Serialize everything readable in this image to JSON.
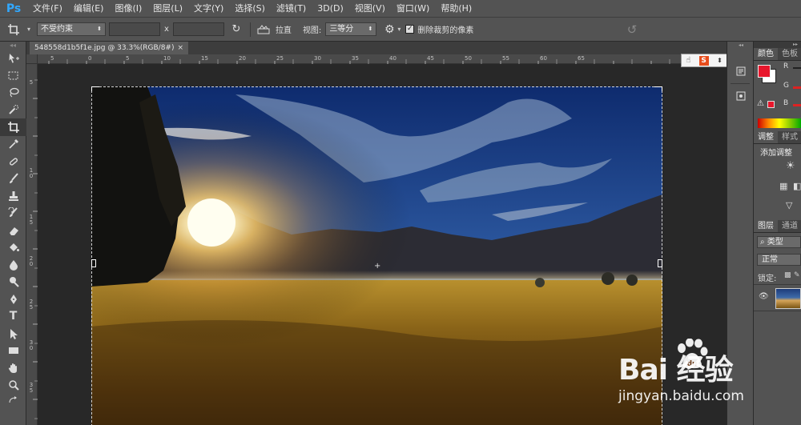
{
  "app": {
    "logo": "Ps"
  },
  "menu": [
    "文件(F)",
    "编辑(E)",
    "图像(I)",
    "图层(L)",
    "文字(Y)",
    "选择(S)",
    "滤镜(T)",
    "3D(D)",
    "视图(V)",
    "窗口(W)",
    "帮助(H)"
  ],
  "options": {
    "ratio_select": "不受约束",
    "x_label": "x",
    "straighten_label": "拉直",
    "view_label": "视图:",
    "view_select": "三等分",
    "delete_cropped_label": "删除裁剪的像素",
    "delete_cropped_checked": true
  },
  "document": {
    "tab_title": "548558d1b5f1e.jpg @ 33.3%(RGB/8#)",
    "close": "×"
  },
  "rulers": {
    "h_ticks": [
      "5",
      "0",
      "5",
      "10",
      "15",
      "20",
      "25",
      "30",
      "35",
      "40",
      "45",
      "50",
      "55",
      "60",
      "65"
    ],
    "v_ticks": [
      "5",
      "1 0",
      "1 5",
      "2 0",
      "2 5",
      "3 0",
      "3 5"
    ]
  },
  "panels": {
    "color_tabs": [
      "颜色",
      "色板"
    ],
    "color_channels": [
      "R",
      "G",
      "B"
    ],
    "adjust_tabs": [
      "调整",
      "样式"
    ],
    "adjust_title": "添加调整",
    "layers_tabs": [
      "图层",
      "通道"
    ],
    "layer_filter": "类型",
    "blend_mode": "正常",
    "lock_label": "锁定:"
  },
  "colors": {
    "foreground": "#e8162c",
    "background": "#ffffff",
    "ps_blue": "#31a8ff"
  },
  "watermark": {
    "logo_text": "Bai 经验",
    "logo_du": "du",
    "url": "jingyan.baidu.com"
  }
}
